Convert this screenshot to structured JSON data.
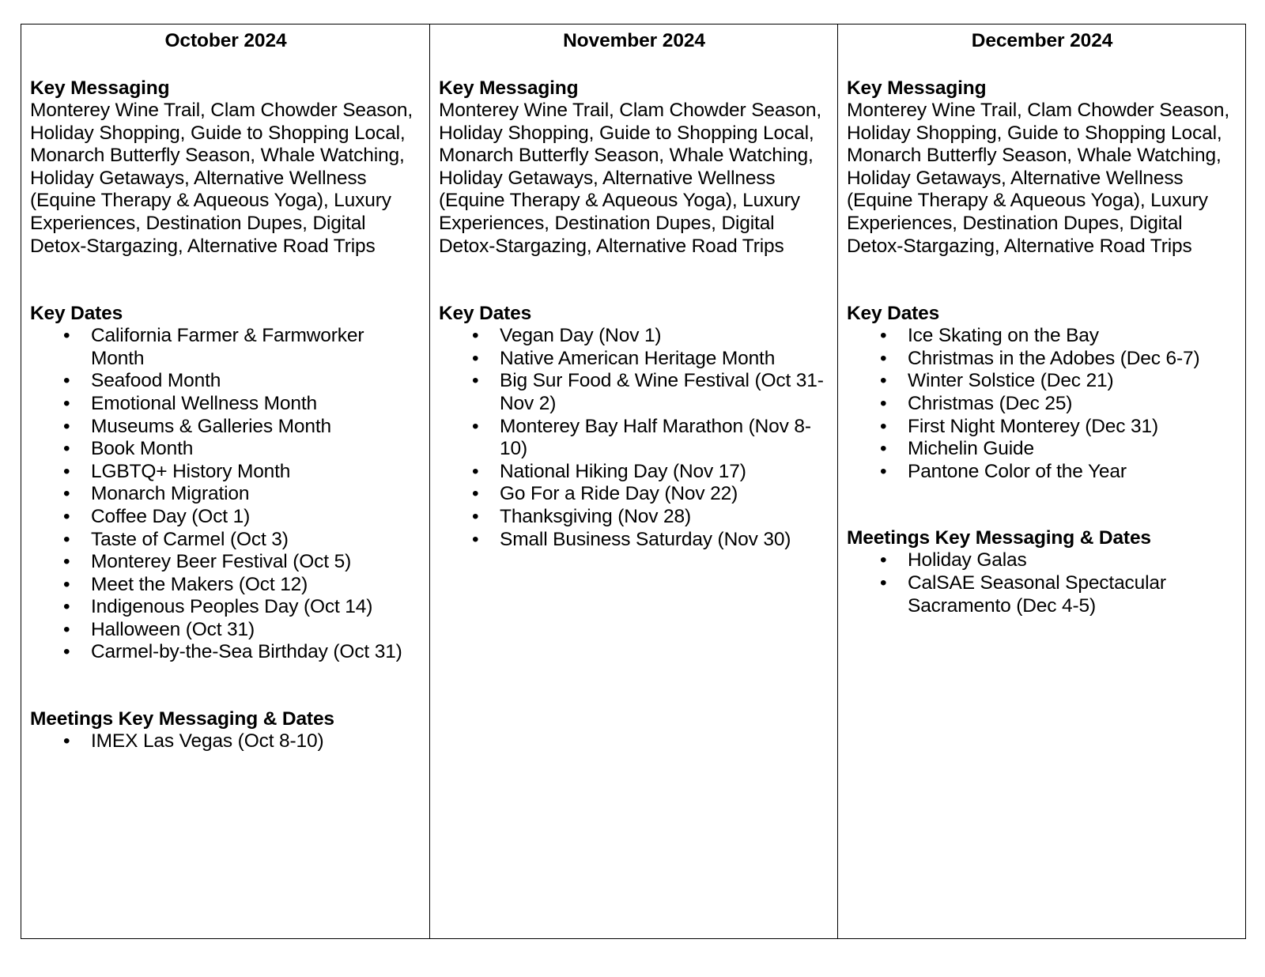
{
  "document": {
    "type": "editorial-calendar-table",
    "bullet_glyph": "•",
    "border_color": "#000000",
    "text_color": "#000000",
    "background_color": "#ffffff"
  },
  "labels": {
    "key_messaging": "Key Messaging",
    "key_dates": "Key Dates",
    "meetings_key_messaging_dates": "Meetings Key Messaging & Dates"
  },
  "months": [
    {
      "title": "October 2024",
      "key_messaging": "Monterey Wine Trail, Clam Chowder Season,\nHoliday Shopping, Guide to Shopping Local,\nMonarch Butterfly Season, Whale Watching,\nHoliday Getaways, Alternative Wellness\n(Equine Therapy & Aqueous Yoga), Luxury\nExperiences, Destination Dupes, Digital\nDetox-Stargazing, Alternative Road Trips",
      "key_dates": [
        "California Farmer & Farmworker Month",
        "Seafood Month",
        "Emotional Wellness Month",
        "Museums & Galleries Month",
        "Book Month",
        "LGBTQ+ History Month",
        "Monarch Migration",
        "Coffee Day (Oct 1)",
        "Taste of Carmel (Oct 3)",
        "Monterey Beer Festival (Oct 5)",
        "Meet the Makers (Oct 12)",
        "Indigenous Peoples Day (Oct 14)",
        "Halloween (Oct 31)",
        "Carmel-by-the-Sea Birthday (Oct 31)"
      ],
      "meetings": [
        "IMEX Las Vegas (Oct 8-10)"
      ]
    },
    {
      "title": "November 2024",
      "key_messaging": "Monterey Wine Trail, Clam Chowder Season,\nHoliday Shopping, Guide to Shopping Local,\nMonarch Butterfly Season, Whale Watching,\nHoliday Getaways, Alternative Wellness\n(Equine Therapy & Aqueous Yoga), Luxury\nExperiences, Destination Dupes, Digital\nDetox-Stargazing, Alternative Road Trips",
      "key_dates": [
        "Vegan Day (Nov 1)",
        "Native American Heritage Month",
        "Big Sur Food & Wine Festival (Oct 31-Nov 2)",
        "Monterey Bay Half Marathon (Nov 8-10)",
        "National Hiking Day (Nov 17)",
        "Go For a Ride Day (Nov 22)",
        "Thanksgiving (Nov 28)",
        "Small Business Saturday (Nov 30)"
      ],
      "meetings": []
    },
    {
      "title": "December 2024",
      "key_messaging": "Monterey Wine Trail, Clam Chowder Season,\nHoliday Shopping, Guide to Shopping Local,\nMonarch Butterfly Season, Whale Watching,\nHoliday Getaways, Alternative Wellness\n(Equine Therapy & Aqueous Yoga), Luxury\nExperiences, Destination Dupes, Digital\nDetox-Stargazing, Alternative Road Trips",
      "key_dates": [
        "Ice Skating on the Bay",
        "Christmas in the Adobes (Dec 6-7)",
        "Winter Solstice (Dec 21)",
        "Christmas (Dec 25)",
        "First Night Monterey (Dec 31)",
        "Michelin Guide",
        "Pantone Color of the Year"
      ],
      "meetings": [
        "Holiday Galas",
        "CalSAE Seasonal Spectacular Sacramento (Dec 4-5)"
      ]
    }
  ]
}
